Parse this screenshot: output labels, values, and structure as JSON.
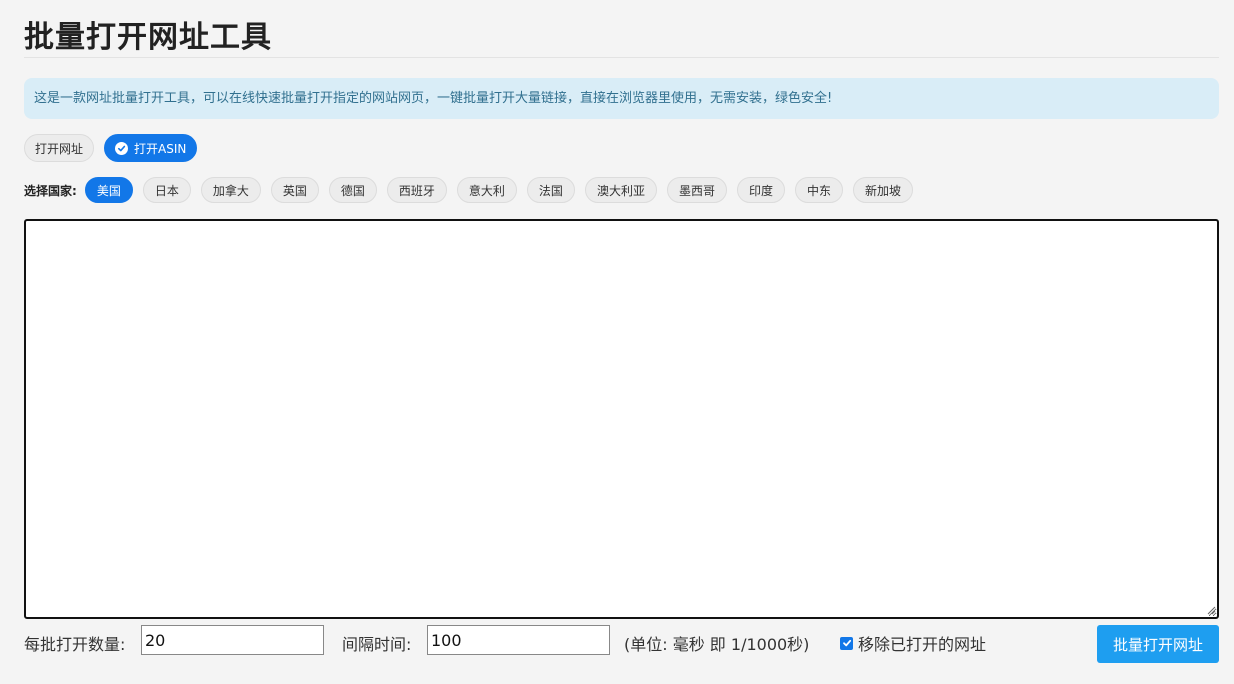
{
  "page": {
    "title": "批量打开网址工具",
    "notice": "这是一款网址批量打开工具，可以在线快速批量打开指定的网站网页，一键批量打开大量链接，直接在浏览器里使用，无需安装，绿色安全!"
  },
  "modes": {
    "items": [
      {
        "label": "打开网址",
        "active": false
      },
      {
        "label": "打开ASIN",
        "active": true
      }
    ]
  },
  "countries": {
    "label": "选择国家:",
    "items": [
      {
        "label": "美国",
        "active": true
      },
      {
        "label": "日本",
        "active": false
      },
      {
        "label": "加拿大",
        "active": false
      },
      {
        "label": "英国",
        "active": false
      },
      {
        "label": "德国",
        "active": false
      },
      {
        "label": "西班牙",
        "active": false
      },
      {
        "label": "意大利",
        "active": false
      },
      {
        "label": "法国",
        "active": false
      },
      {
        "label": "澳大利亚",
        "active": false
      },
      {
        "label": "墨西哥",
        "active": false
      },
      {
        "label": "印度",
        "active": false
      },
      {
        "label": "中东",
        "active": false
      },
      {
        "label": "新加坡",
        "active": false
      }
    ]
  },
  "input_area": {
    "value": ""
  },
  "controls": {
    "batch_label": "每批打开数量:",
    "batch_value": "20",
    "interval_label": "间隔时间:",
    "interval_value": "100",
    "unit_note": "(单位: 毫秒 即 1/1000秒)",
    "remove_opened_label": "移除已打开的网址",
    "remove_opened_checked": true,
    "submit_label": "批量打开网址"
  },
  "colors": {
    "accent": "#1277e8",
    "submit": "#1e9ef0",
    "notice_bg": "#d9edf7",
    "notice_text": "#31708f"
  }
}
